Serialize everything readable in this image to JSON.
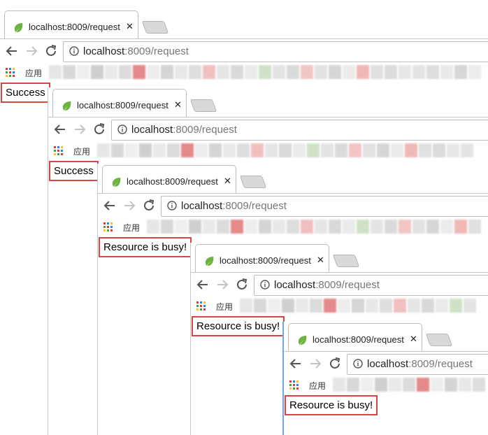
{
  "windows": [
    {
      "tab_title": "localhost:8009/request",
      "url_host": "localhost",
      "url_rest": ":8009/request",
      "apps_label": "应用",
      "response": "Success"
    },
    {
      "tab_title": "localhost:8009/request",
      "url_host": "localhost",
      "url_rest": ":8009/request",
      "apps_label": "应用",
      "response": "Success"
    },
    {
      "tab_title": "localhost:8009/request",
      "url_host": "localhost",
      "url_rest": ":8009/request",
      "apps_label": "应用",
      "response": "Resource is busy!"
    },
    {
      "tab_title": "localhost:8009/request",
      "url_host": "localhost",
      "url_rest": ":8009/request",
      "apps_label": "应用",
      "response": "Resource is busy!"
    },
    {
      "tab_title": "localhost:8009/request",
      "url_host": "localhost",
      "url_rest": ":8009/request",
      "apps_label": "应用",
      "response": "Resource is busy!"
    }
  ],
  "icons": {
    "tab": "spring-leaf-icon",
    "back": "back-arrow-icon",
    "forward": "forward-arrow-icon",
    "reload": "reload-icon",
    "info": "info-icon",
    "apps": "apps-grid-icon",
    "close": "close-icon"
  },
  "colors": {
    "highlight_border": "#d94545",
    "spring_green": "#6db33f"
  }
}
